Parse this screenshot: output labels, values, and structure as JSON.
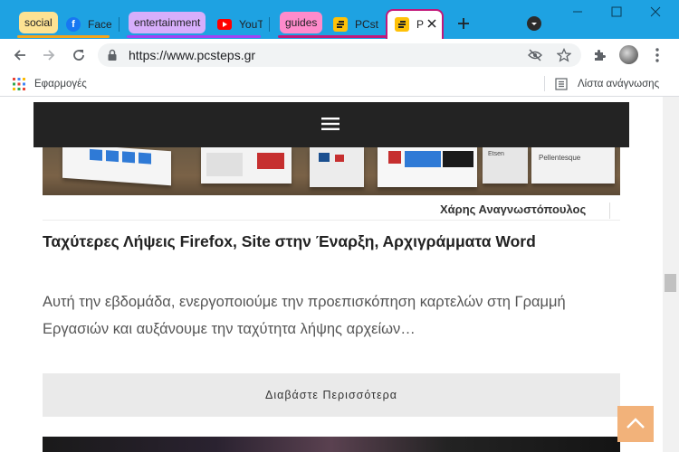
{
  "tabgroups": [
    {
      "name": "social",
      "color": "#fde293",
      "bar": "#fcc934"
    },
    {
      "name": "entertainment",
      "color": "#d7aefb",
      "bar": "#a142f4"
    },
    {
      "name": "guides",
      "color": "#ff8bcb",
      "bar": "#c2187a"
    }
  ],
  "tabs": [
    {
      "label": "Face",
      "icon": "facebook-icon"
    },
    {
      "label": "YouT",
      "icon": "youtube-icon"
    },
    {
      "label": "PCst",
      "icon": "pcsteps-icon"
    },
    {
      "label": "P",
      "icon": "pcsteps-icon"
    }
  ],
  "toolbar": {
    "url": "https://www.pcsteps.gr"
  },
  "bookmarks": {
    "apps_label": "Εφαρμογές",
    "reading_list": "Λίστα ανάγνωσης"
  },
  "article": {
    "author": "Χάρης Αναγνωστόπουλος",
    "title": "Ταχύτερες Λήψεις Firefox, Site στην Έναρξη, Αρχιγράμματα Word",
    "excerpt": "Αυτή την εβδομάδα, ενεργοποιούμε την προεπισκόπηση καρτελών στη Γραμμή Εργασιών και αυξάνουμε την ταχύτητα λήψης αρχείων…",
    "read_more": "Διαβάστε Περισσότερα"
  },
  "image_texts": {
    "search": "Etsen",
    "pellentesque": "Pellentesque"
  },
  "colors": {
    "titlebar": "#1ea2e2",
    "guides_outline": "#c2187a",
    "back_to_top": "#f2b27a"
  }
}
